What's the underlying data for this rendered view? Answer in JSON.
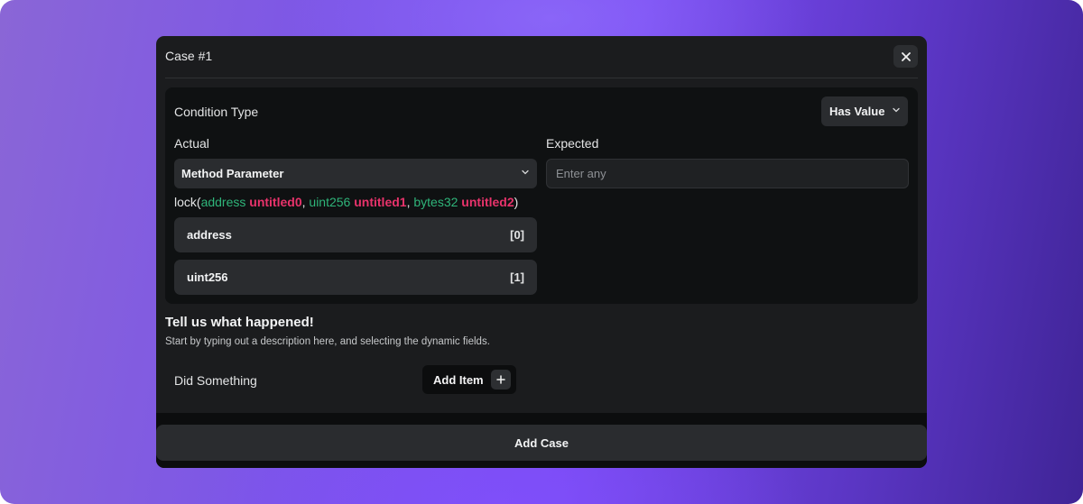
{
  "modal": {
    "title": "Case #1",
    "close_icon": "close-icon"
  },
  "condition": {
    "label": "Condition Type",
    "type_value": "Has Value"
  },
  "actual": {
    "label": "Actual",
    "select_value": "Method Parameter"
  },
  "expected": {
    "label": "Expected",
    "placeholder": "Enter any",
    "value": ""
  },
  "signature": {
    "method": "lock",
    "open": "(",
    "close": ")",
    "separator": ", ",
    "params": [
      {
        "type": "address",
        "name": "untitled0"
      },
      {
        "type": "uint256",
        "name": "untitled1"
      },
      {
        "type": "bytes32",
        "name": "untitled2"
      }
    ]
  },
  "param_list": [
    {
      "name": "address",
      "index": "[0]"
    },
    {
      "name": "uint256",
      "index": "[1]"
    }
  ],
  "description": {
    "title": "Tell us what happened!",
    "subtitle": "Start by typing out a description here, and selecting the dynamic fields."
  },
  "event": {
    "label": "Did Something",
    "add_item_label": "Add Item"
  },
  "footer": {
    "add_case_label": "Add Case"
  },
  "colors": {
    "type_color": "#2fb57a",
    "name_color": "#e8336b",
    "modal_bg": "#1b1c1e",
    "accent_purple": "#7a4bf2"
  }
}
